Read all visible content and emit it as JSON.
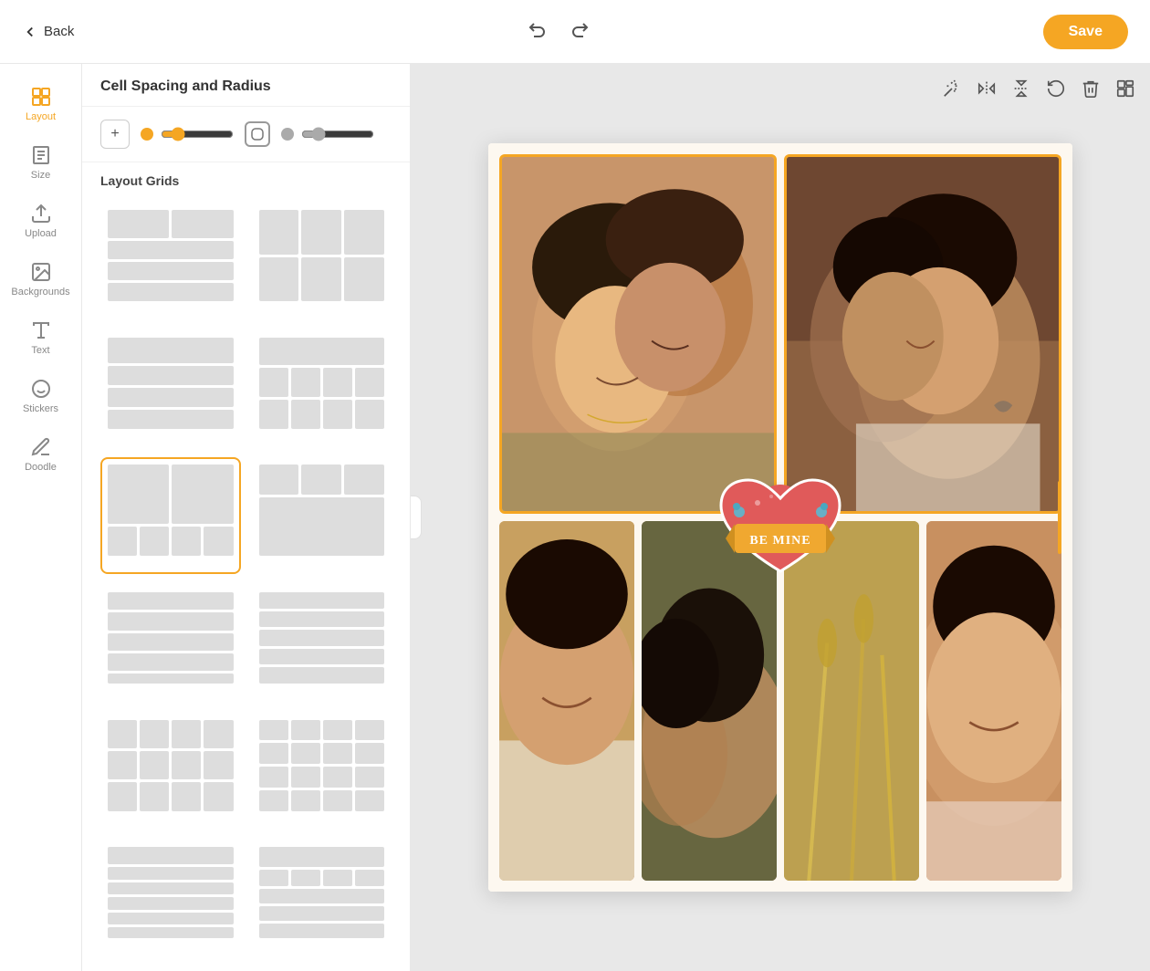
{
  "app": {
    "back_label": "Back",
    "save_label": "Save"
  },
  "panel": {
    "title": "Cell Spacing and Radius",
    "spacing_value": 5,
    "radius_value": 5,
    "section_label": "Layout Grids"
  },
  "nav": {
    "items": [
      {
        "id": "layout",
        "label": "Layout",
        "icon": "grid",
        "active": true
      },
      {
        "id": "size",
        "label": "Size",
        "icon": "size"
      },
      {
        "id": "upload",
        "label": "Upload",
        "icon": "upload"
      },
      {
        "id": "backgrounds",
        "label": "Backgrounds",
        "icon": "backgrounds"
      },
      {
        "id": "text",
        "label": "Text",
        "icon": "text"
      },
      {
        "id": "stickers",
        "label": "Stickers",
        "icon": "stickers"
      },
      {
        "id": "doodle",
        "label": "Doodle",
        "icon": "doodle"
      }
    ]
  },
  "toolbar": {
    "icons": [
      "magic",
      "flip-h",
      "flip-v",
      "rotate",
      "delete",
      "layout-switch"
    ]
  },
  "grid_templates": [
    {
      "id": 1,
      "selected": false
    },
    {
      "id": 2,
      "selected": false
    },
    {
      "id": 3,
      "selected": false
    },
    {
      "id": 4,
      "selected": false
    },
    {
      "id": 5,
      "selected": true
    },
    {
      "id": 6,
      "selected": false
    },
    {
      "id": 7,
      "selected": false
    },
    {
      "id": 8,
      "selected": false
    },
    {
      "id": 9,
      "selected": false
    },
    {
      "id": 10,
      "selected": false
    },
    {
      "id": 11,
      "selected": false
    },
    {
      "id": 12,
      "selected": false
    }
  ],
  "sticker": {
    "be_mine_text": "BE MINE"
  }
}
